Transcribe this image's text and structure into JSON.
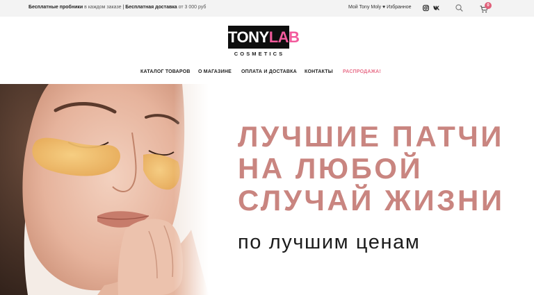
{
  "topbar": {
    "promo_free_samples": "Бесплатные пробники",
    "promo_each_order": "в каждом заказе",
    "promo_sep": "|",
    "promo_free_delivery": "Бесплатная доставка",
    "promo_from": "от",
    "promo_amount": "3 000 руб",
    "my_account": "Мой Tony Moly",
    "favorites": "♥ Избранное",
    "cart_count": "0",
    "icons": [
      "instagram-icon",
      "vk-icon",
      "search-icon",
      "cart-icon"
    ]
  },
  "logo": {
    "word_a": "TONY",
    "word_b": "LAB",
    "subtitle": "COSMETICS",
    "colors": {
      "box": "#0e0e0e",
      "accent": "#f25a9c"
    }
  },
  "nav": {
    "items": [
      {
        "label": "КАТАЛОГ ТОВАРОВ"
      },
      {
        "label": "О МАГАЗИНЕ"
      },
      {
        "label": "ОПЛАТА И ДОСТАВКА"
      },
      {
        "label": "КОНТАКТЫ"
      },
      {
        "label": "РАСПРОДАЖА!"
      }
    ],
    "sale_color": "#e8708a"
  },
  "hero": {
    "headline_lines": [
      "ЛУЧШИЕ ПАТЧИ",
      "НА ЛЮБОЙ",
      "СЛУЧАЙ ЖИЗНИ"
    ],
    "subline": "по лучшим ценам",
    "headline_color": "#c98580"
  }
}
